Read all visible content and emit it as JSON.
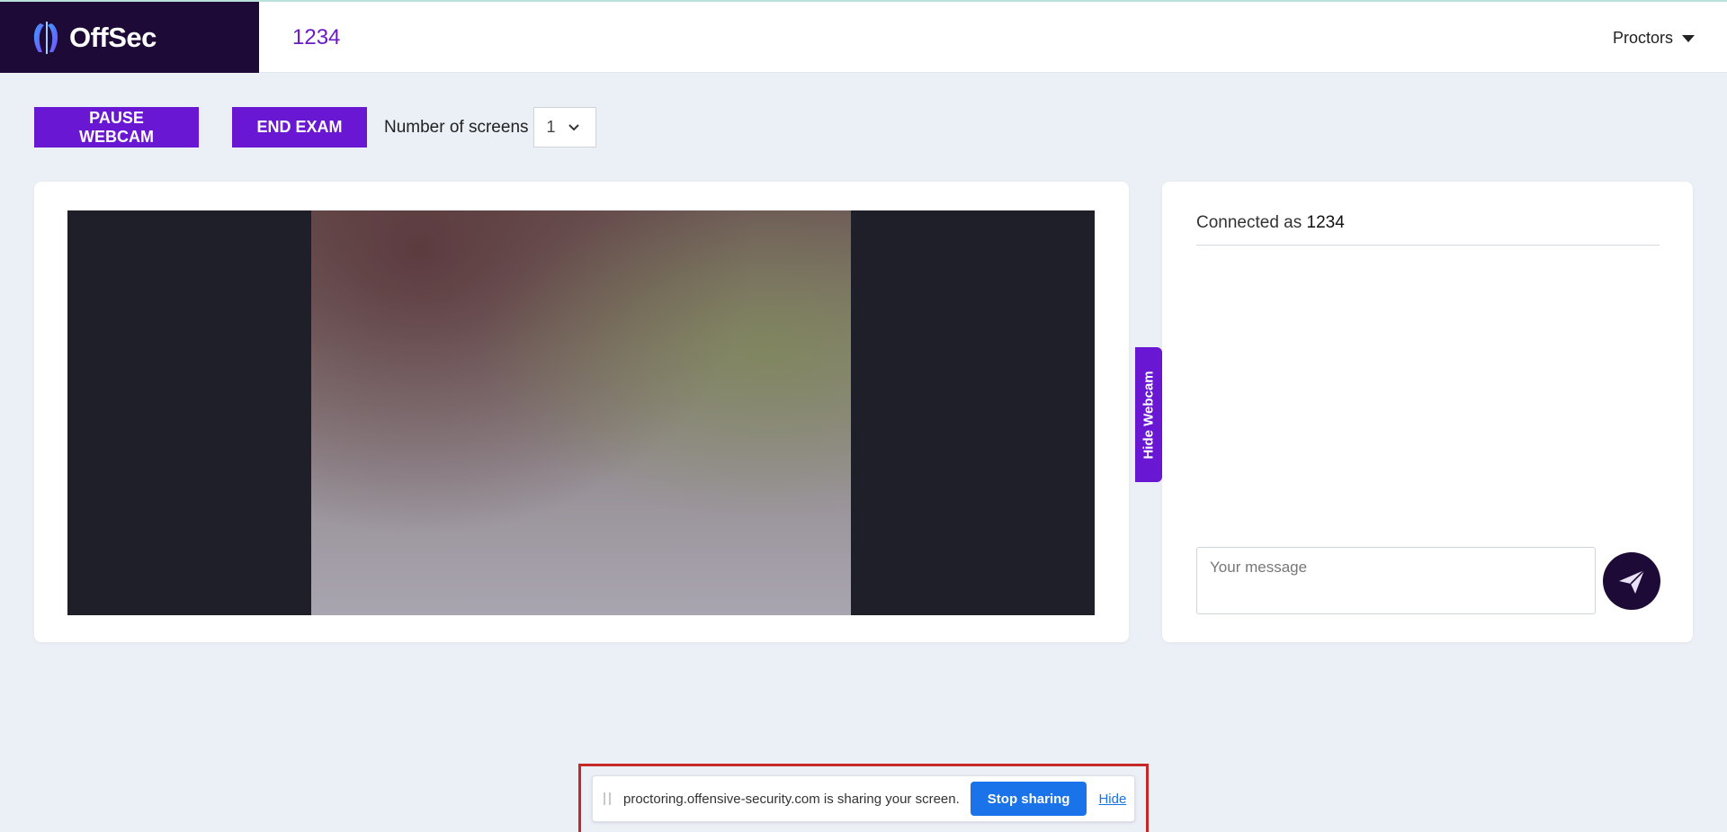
{
  "header": {
    "brand_name": "OffSec",
    "session_id": "1234",
    "proctors_label": "Proctors"
  },
  "toolbar": {
    "pause_label": "PAUSE WEBCAM",
    "end_label": "END EXAM",
    "screens_label": "Number of screens",
    "screens_value": "1"
  },
  "webcam": {
    "hide_label": "Hide Webcam"
  },
  "chat": {
    "connected_prefix": "Connected as",
    "connected_user": "1234",
    "message_placeholder": "Your message"
  },
  "share_bar": {
    "text": "proctoring.offensive-security.com is sharing your screen.",
    "stop_label": "Stop sharing",
    "hide_label": "Hide"
  },
  "colors": {
    "brand_dark": "#1e0a36",
    "accent_purple": "#6a17d4",
    "share_blue": "#1a73e8",
    "highlight_red": "#c62828"
  },
  "icons": [
    "offsec-logo-icon",
    "caret-down-icon",
    "chevron-down-icon",
    "send-icon",
    "drag-handle-icon"
  ]
}
